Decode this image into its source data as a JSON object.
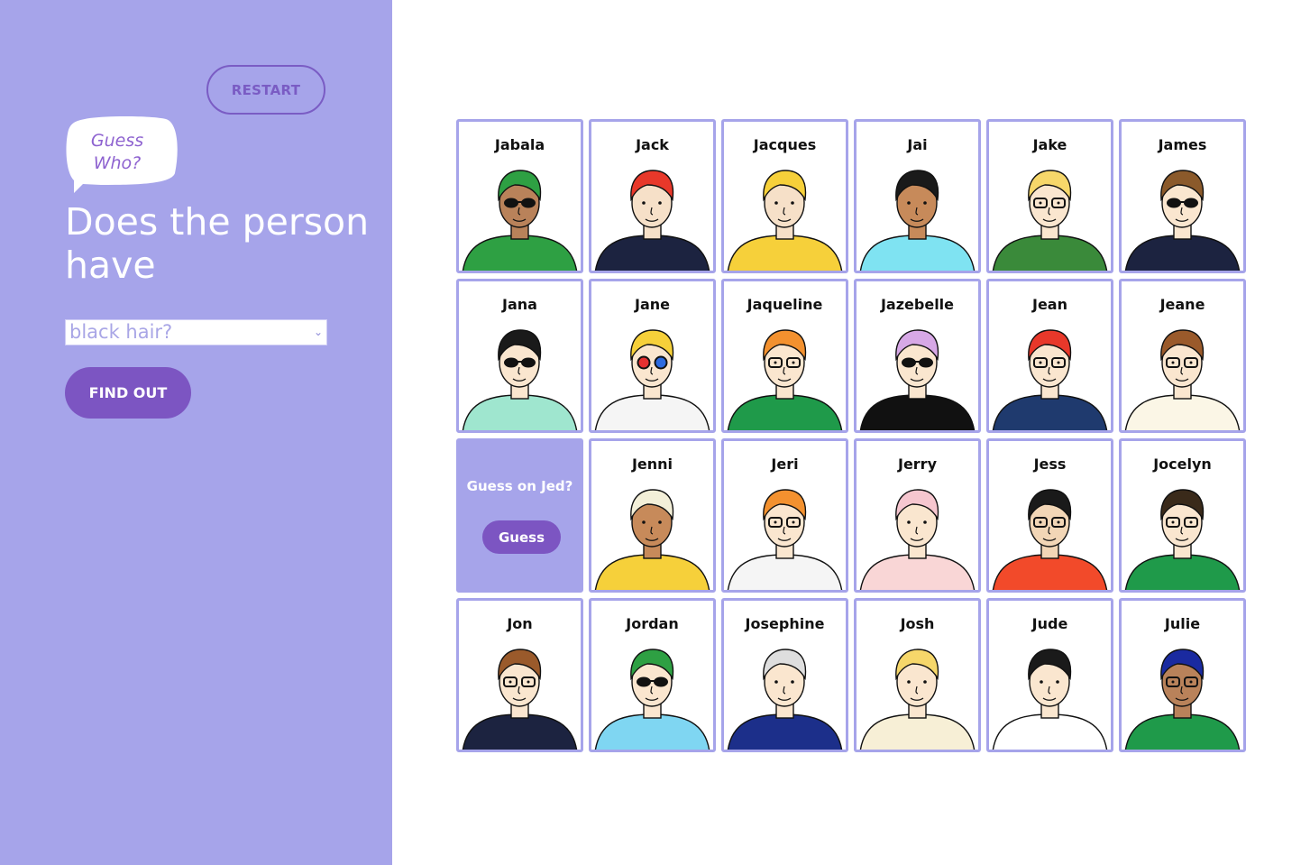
{
  "sidebar": {
    "restart_label": "RESTART",
    "bubble_text": "Guess Who?",
    "heading": "Does the person have",
    "question_select": {
      "value": "black hair?"
    },
    "find_out_label": "FIND OUT"
  },
  "board": {
    "guess_prompt": "Guess on Jed?",
    "guess_button_label": "Guess",
    "characters": [
      {
        "name": "Jabala",
        "skin": "#b9825a",
        "hair": "#2ea043",
        "shirt": "#2ea043",
        "glasses": "sun"
      },
      {
        "name": "Jack",
        "skin": "#f6e0c8",
        "hair": "#e8382a",
        "shirt": "#1c2340",
        "glasses": "none"
      },
      {
        "name": "Jacques",
        "skin": "#f6e0c8",
        "hair": "#f6d03a",
        "shirt": "#f6d03a",
        "glasses": "none"
      },
      {
        "name": "Jai",
        "skin": "#c78a5a",
        "hair": "#1a1a1a",
        "shirt": "#7fe3f2",
        "glasses": "none"
      },
      {
        "name": "Jake",
        "skin": "#fae6cf",
        "hair": "#f6d76a",
        "shirt": "#3a8a3a",
        "glasses": "clear"
      },
      {
        "name": "James",
        "skin": "#fae6cf",
        "hair": "#8b5a2b",
        "shirt": "#1c2340",
        "glasses": "sun"
      },
      {
        "name": "Jana",
        "skin": "#fae6cf",
        "hair": "#1a1a1a",
        "shirt": "#9fe6cf",
        "glasses": "sun"
      },
      {
        "name": "Jane",
        "skin": "#fae6cf",
        "hair": "#f6d03a",
        "shirt": "#f5f5f5",
        "glasses": "color"
      },
      {
        "name": "Jaqueline",
        "skin": "#fae6cf",
        "hair": "#f3912f",
        "shirt": "#1f9a4a",
        "glasses": "clear"
      },
      {
        "name": "Jazebelle",
        "skin": "#fae6cf",
        "hair": "#d7a8e6",
        "shirt": "#111111",
        "glasses": "sun"
      },
      {
        "name": "Jean",
        "skin": "#fae6cf",
        "hair": "#e8382a",
        "shirt": "#1f3a6e",
        "glasses": "clear"
      },
      {
        "name": "Jeane",
        "skin": "#fae6cf",
        "hair": "#9a5a2b",
        "shirt": "#fbf6e6",
        "glasses": "clear"
      },
      {
        "name": "Jenni",
        "skin": "#c78a5a",
        "hair": "#f3efd8",
        "shirt": "#f6d03a",
        "glasses": "none"
      },
      {
        "name": "Jeri",
        "skin": "#fae6cf",
        "hair": "#f3912f",
        "shirt": "#f5f5f5",
        "glasses": "clear"
      },
      {
        "name": "Jerry",
        "skin": "#fae6cf",
        "hair": "#f6c6cf",
        "shirt": "#f9d6d6",
        "glasses": "none"
      },
      {
        "name": "Jess",
        "skin": "#f2d6b6",
        "hair": "#1a1a1a",
        "shirt": "#f24a2a",
        "glasses": "clear"
      },
      {
        "name": "Jocelyn",
        "skin": "#fae6cf",
        "hair": "#3a2a1a",
        "shirt": "#1f9a4a",
        "glasses": "clear"
      },
      {
        "name": "Jon",
        "skin": "#fae6cf",
        "hair": "#9a5a2b",
        "shirt": "#1c2340",
        "glasses": "clear"
      },
      {
        "name": "Jordan",
        "skin": "#fae6cf",
        "hair": "#2ea043",
        "shirt": "#7fd6f2",
        "glasses": "sun"
      },
      {
        "name": "Josephine",
        "skin": "#fae6cf",
        "hair": "#dedede",
        "shirt": "#1c2f8a",
        "glasses": "none"
      },
      {
        "name": "Josh",
        "skin": "#fae6cf",
        "hair": "#f6d76a",
        "shirt": "#f7efd6",
        "glasses": "none"
      },
      {
        "name": "Jude",
        "skin": "#fae6cf",
        "hair": "#1a1a1a",
        "shirt": "#ffffff",
        "glasses": "none"
      },
      {
        "name": "Julie",
        "skin": "#b9825a",
        "hair": "#1a2aa0",
        "shirt": "#1f9a4a",
        "glasses": "clear"
      }
    ]
  }
}
